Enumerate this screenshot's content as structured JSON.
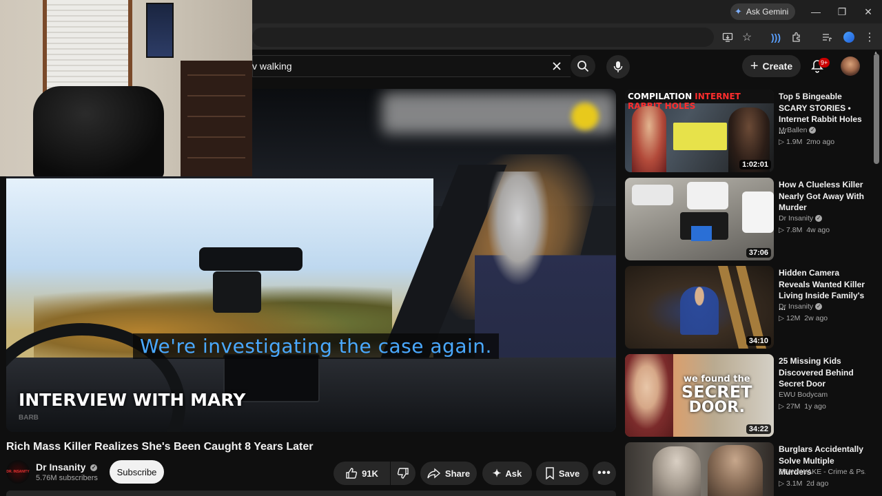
{
  "browser": {
    "ask_gemini": "Ask Gemini",
    "window_controls": [
      "minimize-icon",
      "restore-icon",
      "close-icon"
    ],
    "toolbar_icons": [
      "install-app-icon",
      "bookmark-star-icon",
      "voice-extension-icon",
      "extensions-icon",
      "media-controls-icon",
      "profile-extension-icon",
      "menu-kebab-icon"
    ]
  },
  "header": {
    "search_value": "v walking",
    "create_label": "Create",
    "notification_count": "9+"
  },
  "video": {
    "caption": "We're investigating the case again.",
    "lower_third": "INTERVIEW WITH MARY",
    "lower_third_sub": "BARB",
    "title": "Rich Mass Killer Realizes She's Been Caught 8 Years Later"
  },
  "channel": {
    "name": "Dr Insanity",
    "subscribers": "5.76M subscribers",
    "avatar_text": "DR. INSANITY",
    "subscribe_label": "Subscribe"
  },
  "actions": {
    "likes": "91K",
    "share": "Share",
    "ask": "Ask",
    "save": "Save"
  },
  "recommendations": [
    {
      "title_lines": [
        "Top 5 Bingeable",
        "SCARY STORIES •",
        "Internet Rabbit Holes ..."
      ],
      "channel": "MrBallen",
      "verified": true,
      "views": "1.9M",
      "age": "2mo ago",
      "duration": "1:02:01",
      "thumb_banner_a": "COMPILATION",
      "thumb_banner_b": "INTERNET RABBIT HOLES"
    },
    {
      "title_lines": [
        "How A Clueless Killer",
        "Nearly Got Away With",
        "Murder"
      ],
      "channel": "Dr Insanity",
      "verified": true,
      "views": "7.8M",
      "age": "4w ago",
      "duration": "37:06"
    },
    {
      "title_lines": [
        "Hidden Camera",
        "Reveals Wanted Killer",
        "Living Inside Family's ..."
      ],
      "channel": "Dr Insanity",
      "verified": true,
      "views": "12M",
      "age": "2w ago",
      "duration": "34:10"
    },
    {
      "title_lines": [
        "25 Missing Kids",
        "Discovered Behind",
        "Secret Door"
      ],
      "channel": "EWU Bodycam",
      "verified": false,
      "views": "27M",
      "age": "1y ago",
      "duration": "34:22",
      "thumb_text_a": "we found the",
      "thumb_text_b": "SECRET",
      "thumb_text_c": "DOOR."
    },
    {
      "title_lines": [
        "Burglars Accidentally",
        "Solve Multiple Murders",
        ""
      ],
      "channel": "STAYAWAKE - Crime & Ps...",
      "verified": false,
      "views": "3.1M",
      "age": "2d ago",
      "duration": ""
    }
  ]
}
